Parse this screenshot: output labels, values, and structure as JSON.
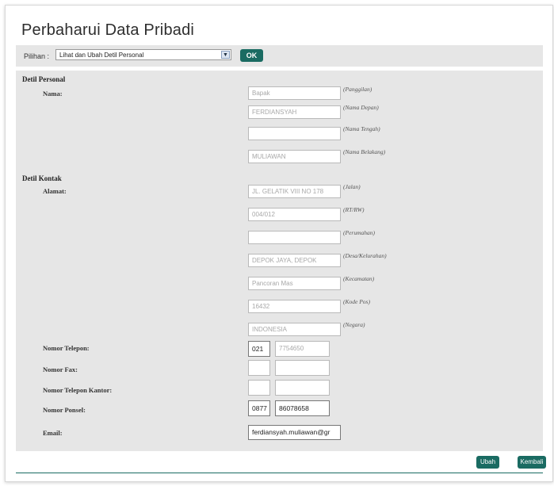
{
  "page": {
    "title": "Perbaharui Data Pribadi"
  },
  "toolbar": {
    "pilihan_label": "Pilihan :",
    "select_value": "Lihat dan Ubah Detil Personal",
    "ok_label": "OK"
  },
  "personal": {
    "heading": "Detil Personal",
    "nama_label": "Nama:",
    "fields": [
      {
        "value": "Bapak",
        "hint": "(Panggilan)"
      },
      {
        "value": "FERDIANSYAH",
        "hint": "(Nama Depan)"
      },
      {
        "value": "",
        "hint": "(Nama Tengah)"
      },
      {
        "value": "MULIAWAN",
        "hint": "(Nama Belakang)"
      }
    ]
  },
  "kontak": {
    "heading": "Detil Kontak",
    "alamat_label": "Alamat:",
    "address": [
      {
        "value": "JL. GELATIK VIII NO 178",
        "hint": "(Jalan)"
      },
      {
        "value": "004/012",
        "hint": "(RT/RW)"
      },
      {
        "value": "",
        "hint": "(Perumahan)"
      },
      {
        "value": "DEPOK JAYA, DEPOK",
        "hint": "(Desa/Kelurahan)"
      },
      {
        "value": "Pancoran Mas",
        "hint": "(Kecamatan)"
      },
      {
        "value": "16432",
        "hint": "(Kode Pos)"
      },
      {
        "value": "INDONESIA",
        "hint": "(Negara)"
      }
    ],
    "telepon": {
      "label": "Nomor Telepon:",
      "area": "021",
      "number": "7754650"
    },
    "fax": {
      "label": "Nomor Fax:",
      "area": "",
      "number": ""
    },
    "kantor": {
      "label": "Nomor Telepon Kantor:",
      "area": "",
      "number": ""
    },
    "ponsel": {
      "label": "Nomor Ponsel:",
      "area": "0877",
      "number": "86078658"
    },
    "email": {
      "label": "Email:",
      "value": "ferdiansyah.muliawan@gr"
    }
  },
  "actions": {
    "ubah_label": "Ubah",
    "kembali_label": "Kembali"
  },
  "colors": {
    "accent": "#1a6b62",
    "panel": "#e6e6e6"
  }
}
